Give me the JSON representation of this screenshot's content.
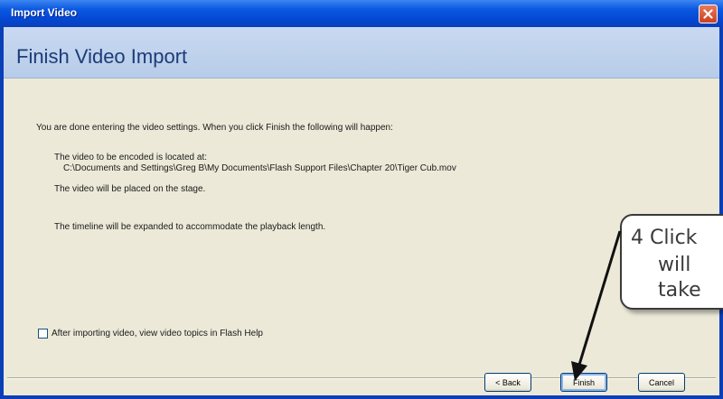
{
  "window": {
    "title": "Import Video"
  },
  "header": {
    "title": "Finish Video Import"
  },
  "content": {
    "intro": "You are done entering the video settings. When you click Finish the following will happen:",
    "encoded_label": "The video to be encoded is located at:",
    "path": "C:\\Documents and Settings\\Greg B\\My Documents\\Flash Support Files\\Chapter 20\\Tiger Cub.mov",
    "placed_text": "The video will be placed on the stage.",
    "timeline_text": "The timeline will be expanded to accommodate the playback length.",
    "checkbox_label": "After importing video, view video topics in Flash Help",
    "checkbox_checked": false
  },
  "buttons": {
    "back": "< Back",
    "finish": "Finish",
    "cancel": "Cancel"
  },
  "callout": {
    "line1": "4  Click",
    "line2": "will",
    "line3": "take"
  },
  "icons": {
    "close": "close-icon",
    "arrow": "arrow-icon"
  }
}
